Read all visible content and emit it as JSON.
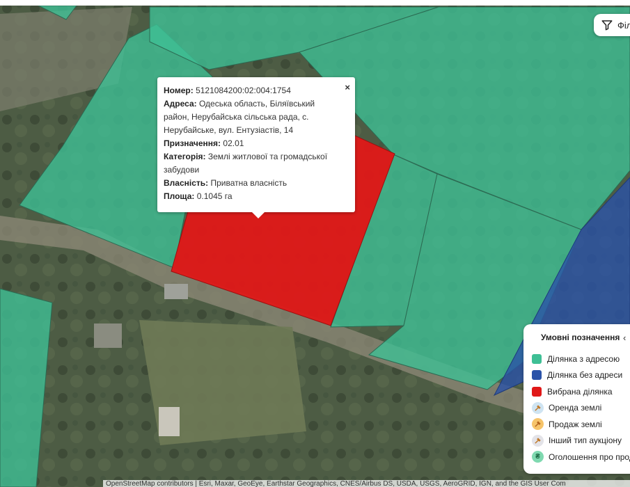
{
  "popup": {
    "rows": [
      {
        "label": "Номер:",
        "value": "5121084200:02:004:1754"
      },
      {
        "label": "Адреса:",
        "value": "Одеська область, Біляївський район, Нерубайська сільська рада, с. Нерубайське, вул. Ентузіастів, 14"
      },
      {
        "label": "Призначення:",
        "value": "02.01"
      },
      {
        "label": "Категорія:",
        "value": "Землі житлової та громадської забудови"
      },
      {
        "label": "Власність:",
        "value": "Приватна власність"
      },
      {
        "label": "Площа:",
        "value": "0.1045 га"
      }
    ],
    "close": "×"
  },
  "filter": {
    "label": "Філ",
    "icon": "filter-icon"
  },
  "legend": {
    "title": "Умовні позначення",
    "collapse_icon": "chevron-left-icon",
    "collapse_glyph": "‹",
    "items": [
      {
        "label": "Ділянка з адресою",
        "color": "#3ebf95",
        "kind": "swatch"
      },
      {
        "label": "Ділянка без адреси",
        "color": "#2a52a8",
        "kind": "swatch"
      },
      {
        "label": "Вибрана ділянка",
        "color": "#e01818",
        "kind": "swatch"
      },
      {
        "label": "Оренда землі",
        "color": "#cfe4f2",
        "kind": "icon",
        "icon": "auction-rent-icon"
      },
      {
        "label": "Продаж землі",
        "color": "#f6c46a",
        "kind": "icon",
        "icon": "auction-sale-icon"
      },
      {
        "label": "Інший тип аукціону",
        "color": "#e3e3e8",
        "kind": "icon",
        "icon": "auction-other-icon"
      },
      {
        "label": "Оголошення про прод",
        "color": "#7fd9b0",
        "kind": "icon",
        "icon": "hryvnia-icon",
        "glyph": "₴"
      }
    ]
  },
  "attribution": "OpenStreetMap contributors | Esri, Maxar, GeoEye, Earthstar Geographics, CNES/Airbus DS, USDA, USGS, AeroGRID, IGN, and the GIS User Com",
  "colors": {
    "with_address": "#3ebf95",
    "without_address": "#2a52a8",
    "selected": "#e01818"
  }
}
